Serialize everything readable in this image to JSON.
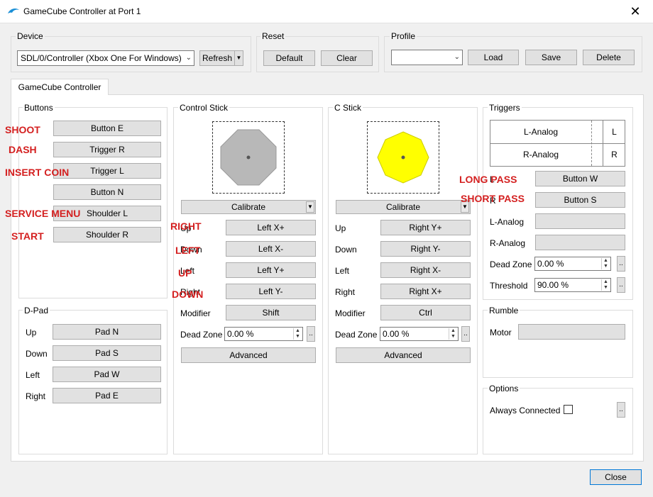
{
  "window": {
    "title": "GameCube Controller at Port 1"
  },
  "device": {
    "label": "Device",
    "selected": "SDL/0/Controller (Xbox One For Windows)",
    "refresh": "Refresh"
  },
  "reset": {
    "label": "Reset",
    "default": "Default",
    "clear": "Clear"
  },
  "profile": {
    "label": "Profile",
    "selected": "",
    "load": "Load",
    "save": "Save",
    "delete": "Delete"
  },
  "tab": "GameCube Controller",
  "buttons": {
    "label": "Buttons",
    "items": [
      "Button E",
      "Trigger R",
      "Trigger L",
      "Button N",
      "Shoulder L",
      "Shoulder R"
    ]
  },
  "dpad": {
    "label": "D-Pad",
    "items": [
      {
        "label": "Up",
        "value": "Pad N"
      },
      {
        "label": "Down",
        "value": "Pad S"
      },
      {
        "label": "Left",
        "value": "Pad W"
      },
      {
        "label": "Right",
        "value": "Pad E"
      }
    ]
  },
  "control_stick": {
    "label": "Control Stick",
    "calibrate": "Calibrate",
    "rows": [
      {
        "label": "Up",
        "value": "Left X+"
      },
      {
        "label": "Down",
        "value": "Left X-"
      },
      {
        "label": "Left",
        "value": "Left Y+"
      },
      {
        "label": "Right",
        "value": "Left Y-"
      },
      {
        "label": "Modifier",
        "value": "Shift"
      }
    ],
    "deadzone_label": "Dead Zone",
    "deadzone": "0.00 %",
    "advanced": "Advanced",
    "fill_color": "#b8b8b8"
  },
  "c_stick": {
    "label": "C Stick",
    "calibrate": "Calibrate",
    "rows": [
      {
        "label": "Up",
        "value": "Right Y+"
      },
      {
        "label": "Down",
        "value": "Right Y-"
      },
      {
        "label": "Left",
        "value": "Right X-"
      },
      {
        "label": "Right",
        "value": "Right X+"
      },
      {
        "label": "Modifier",
        "value": "Ctrl"
      }
    ],
    "deadzone_label": "Dead Zone",
    "deadzone": "0.00 %",
    "advanced": "Advanced",
    "fill_color": "#ffff00"
  },
  "triggers": {
    "label": "Triggers",
    "table": [
      {
        "name": "L-Analog",
        "key": "L"
      },
      {
        "name": "R-Analog",
        "key": "R"
      }
    ],
    "rows": [
      {
        "label": "L",
        "value": "Button W"
      },
      {
        "label": "R",
        "value": "Button S"
      },
      {
        "label": "L-Analog",
        "value": ""
      },
      {
        "label": "R-Analog",
        "value": ""
      }
    ],
    "deadzone_label": "Dead Zone",
    "deadzone": "0.00 %",
    "threshold_label": "Threshold",
    "threshold": "90.00 %"
  },
  "rumble": {
    "label": "Rumble",
    "motor": "Motor",
    "motor_value": ""
  },
  "options": {
    "label": "Options",
    "always_connected": "Always Connected"
  },
  "close": "Close",
  "annotations": {
    "shoot": "SHOOT",
    "dash": "DASH",
    "insert_coin": "INSERT COIN",
    "service_menu": "SERVICE MENU",
    "start": "START",
    "right": "RIGHT",
    "left": "LEFT",
    "up": "UP",
    "down": "DOWN",
    "long_pass": "LONG PASS",
    "short_pass": "SHORT PASS"
  }
}
